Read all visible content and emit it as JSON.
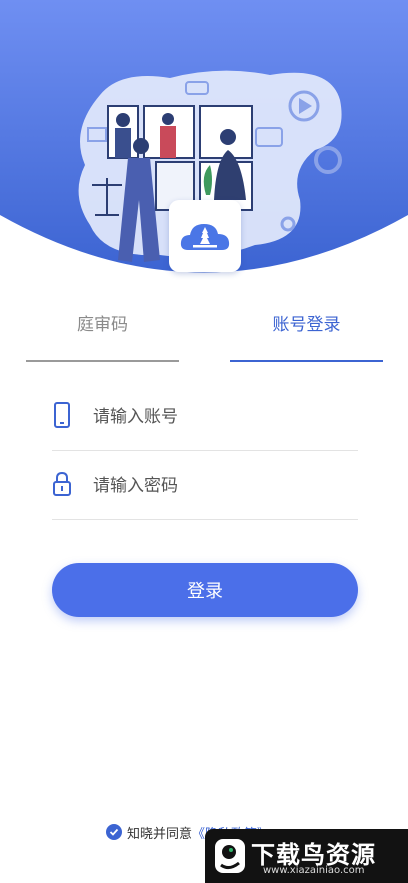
{
  "colors": {
    "brand_blue": "#4b6fe9",
    "hero_gradient_top": "#6f8ff2",
    "hero_gradient_bottom": "#3c64d2",
    "tab_active": "#3c64d2",
    "tab_inactive": "#8a8a8a"
  },
  "hero": {
    "illustration": "video-court-hearing-illustration",
    "logo_icon": "court-building-cloud-icon"
  },
  "tabs": [
    {
      "label": "庭审码",
      "active": false
    },
    {
      "label": "账号登录",
      "active": true
    }
  ],
  "form": {
    "account": {
      "placeholder": "请输入账号",
      "icon": "phone-icon"
    },
    "password": {
      "placeholder": "请输入密码",
      "icon": "lock-icon"
    },
    "login_label": "登录"
  },
  "agreement": {
    "checked": true,
    "text": "知晓并同意",
    "policy_link": "《隐私政策》"
  },
  "watermark": {
    "title": "下载鸟资源",
    "url": "www.xiazainiao.com",
    "icon": "bird-logo-icon"
  }
}
